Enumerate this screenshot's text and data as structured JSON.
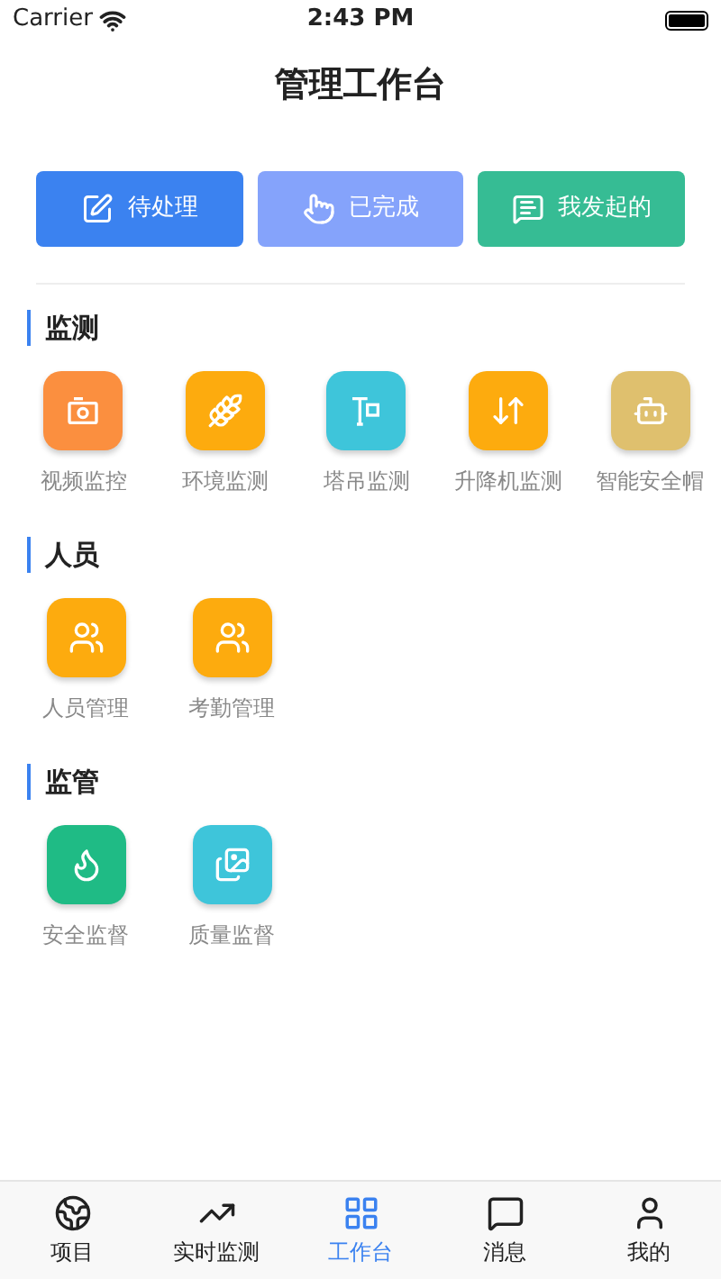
{
  "status_bar": {
    "carrier": "Carrier",
    "time": "2:43 PM"
  },
  "title": "管理工作台",
  "actions": [
    {
      "label": "待处理",
      "color": "#3b82f0"
    },
    {
      "label": "已完成",
      "color": "#85a3fb"
    },
    {
      "label": "我发起的",
      "color": "#36bc94"
    }
  ],
  "sections": [
    {
      "title": "监测",
      "items": [
        {
          "label": "视频监控",
          "color": "#fb8f3f"
        },
        {
          "label": "环境监测",
          "color": "#fdab0e"
        },
        {
          "label": "塔吊监测",
          "color": "#3ec5da"
        },
        {
          "label": "升降机监测",
          "color": "#fdab0e"
        },
        {
          "label": "智能安全帽",
          "color": "#dfc06e"
        }
      ]
    },
    {
      "title": "人员",
      "items": [
        {
          "label": "人员管理",
          "color": "#fdab0e"
        },
        {
          "label": "考勤管理",
          "color": "#fdab0e"
        }
      ]
    },
    {
      "title": "监管",
      "items": [
        {
          "label": "安全监督",
          "color": "#1fbb85"
        },
        {
          "label": "质量监督",
          "color": "#3ec5da"
        }
      ]
    }
  ],
  "tabs": [
    {
      "label": "项目",
      "selected": false
    },
    {
      "label": "实时监测",
      "selected": false
    },
    {
      "label": "工作台",
      "selected": true
    },
    {
      "label": "消息",
      "selected": false
    },
    {
      "label": "我的",
      "selected": false
    }
  ]
}
